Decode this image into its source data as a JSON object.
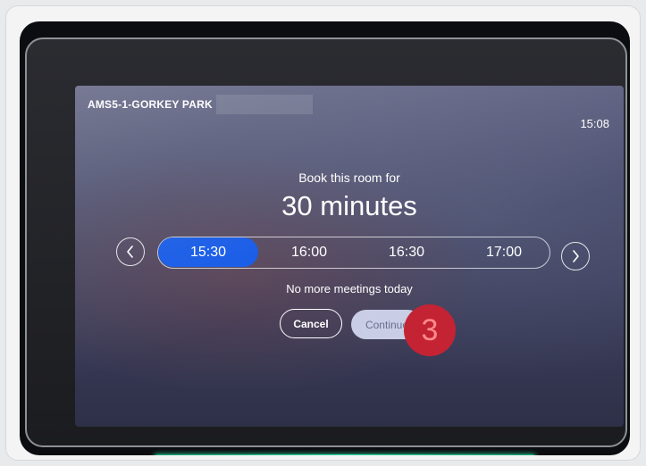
{
  "header": {
    "room_name": "AMS5-1-GORKEY PARK",
    "time": "15:08"
  },
  "booking": {
    "prompt": "Book this room for",
    "duration": "30 minutes",
    "slots": [
      {
        "label": "15:30",
        "selected": true
      },
      {
        "label": "16:00",
        "selected": false
      },
      {
        "label": "16:30",
        "selected": false
      },
      {
        "label": "17:00",
        "selected": false
      }
    ],
    "status": "No more meetings today"
  },
  "actions": {
    "cancel_label": "Cancel",
    "continue_label": "Continue"
  },
  "overlay": {
    "step_number": "3",
    "step_color": "#c42334"
  },
  "icons": {
    "prev": "chevron-left-icon",
    "next": "chevron-right-icon"
  },
  "colors": {
    "selected_slot": "#1459e6",
    "led": "#3ee3b0"
  }
}
